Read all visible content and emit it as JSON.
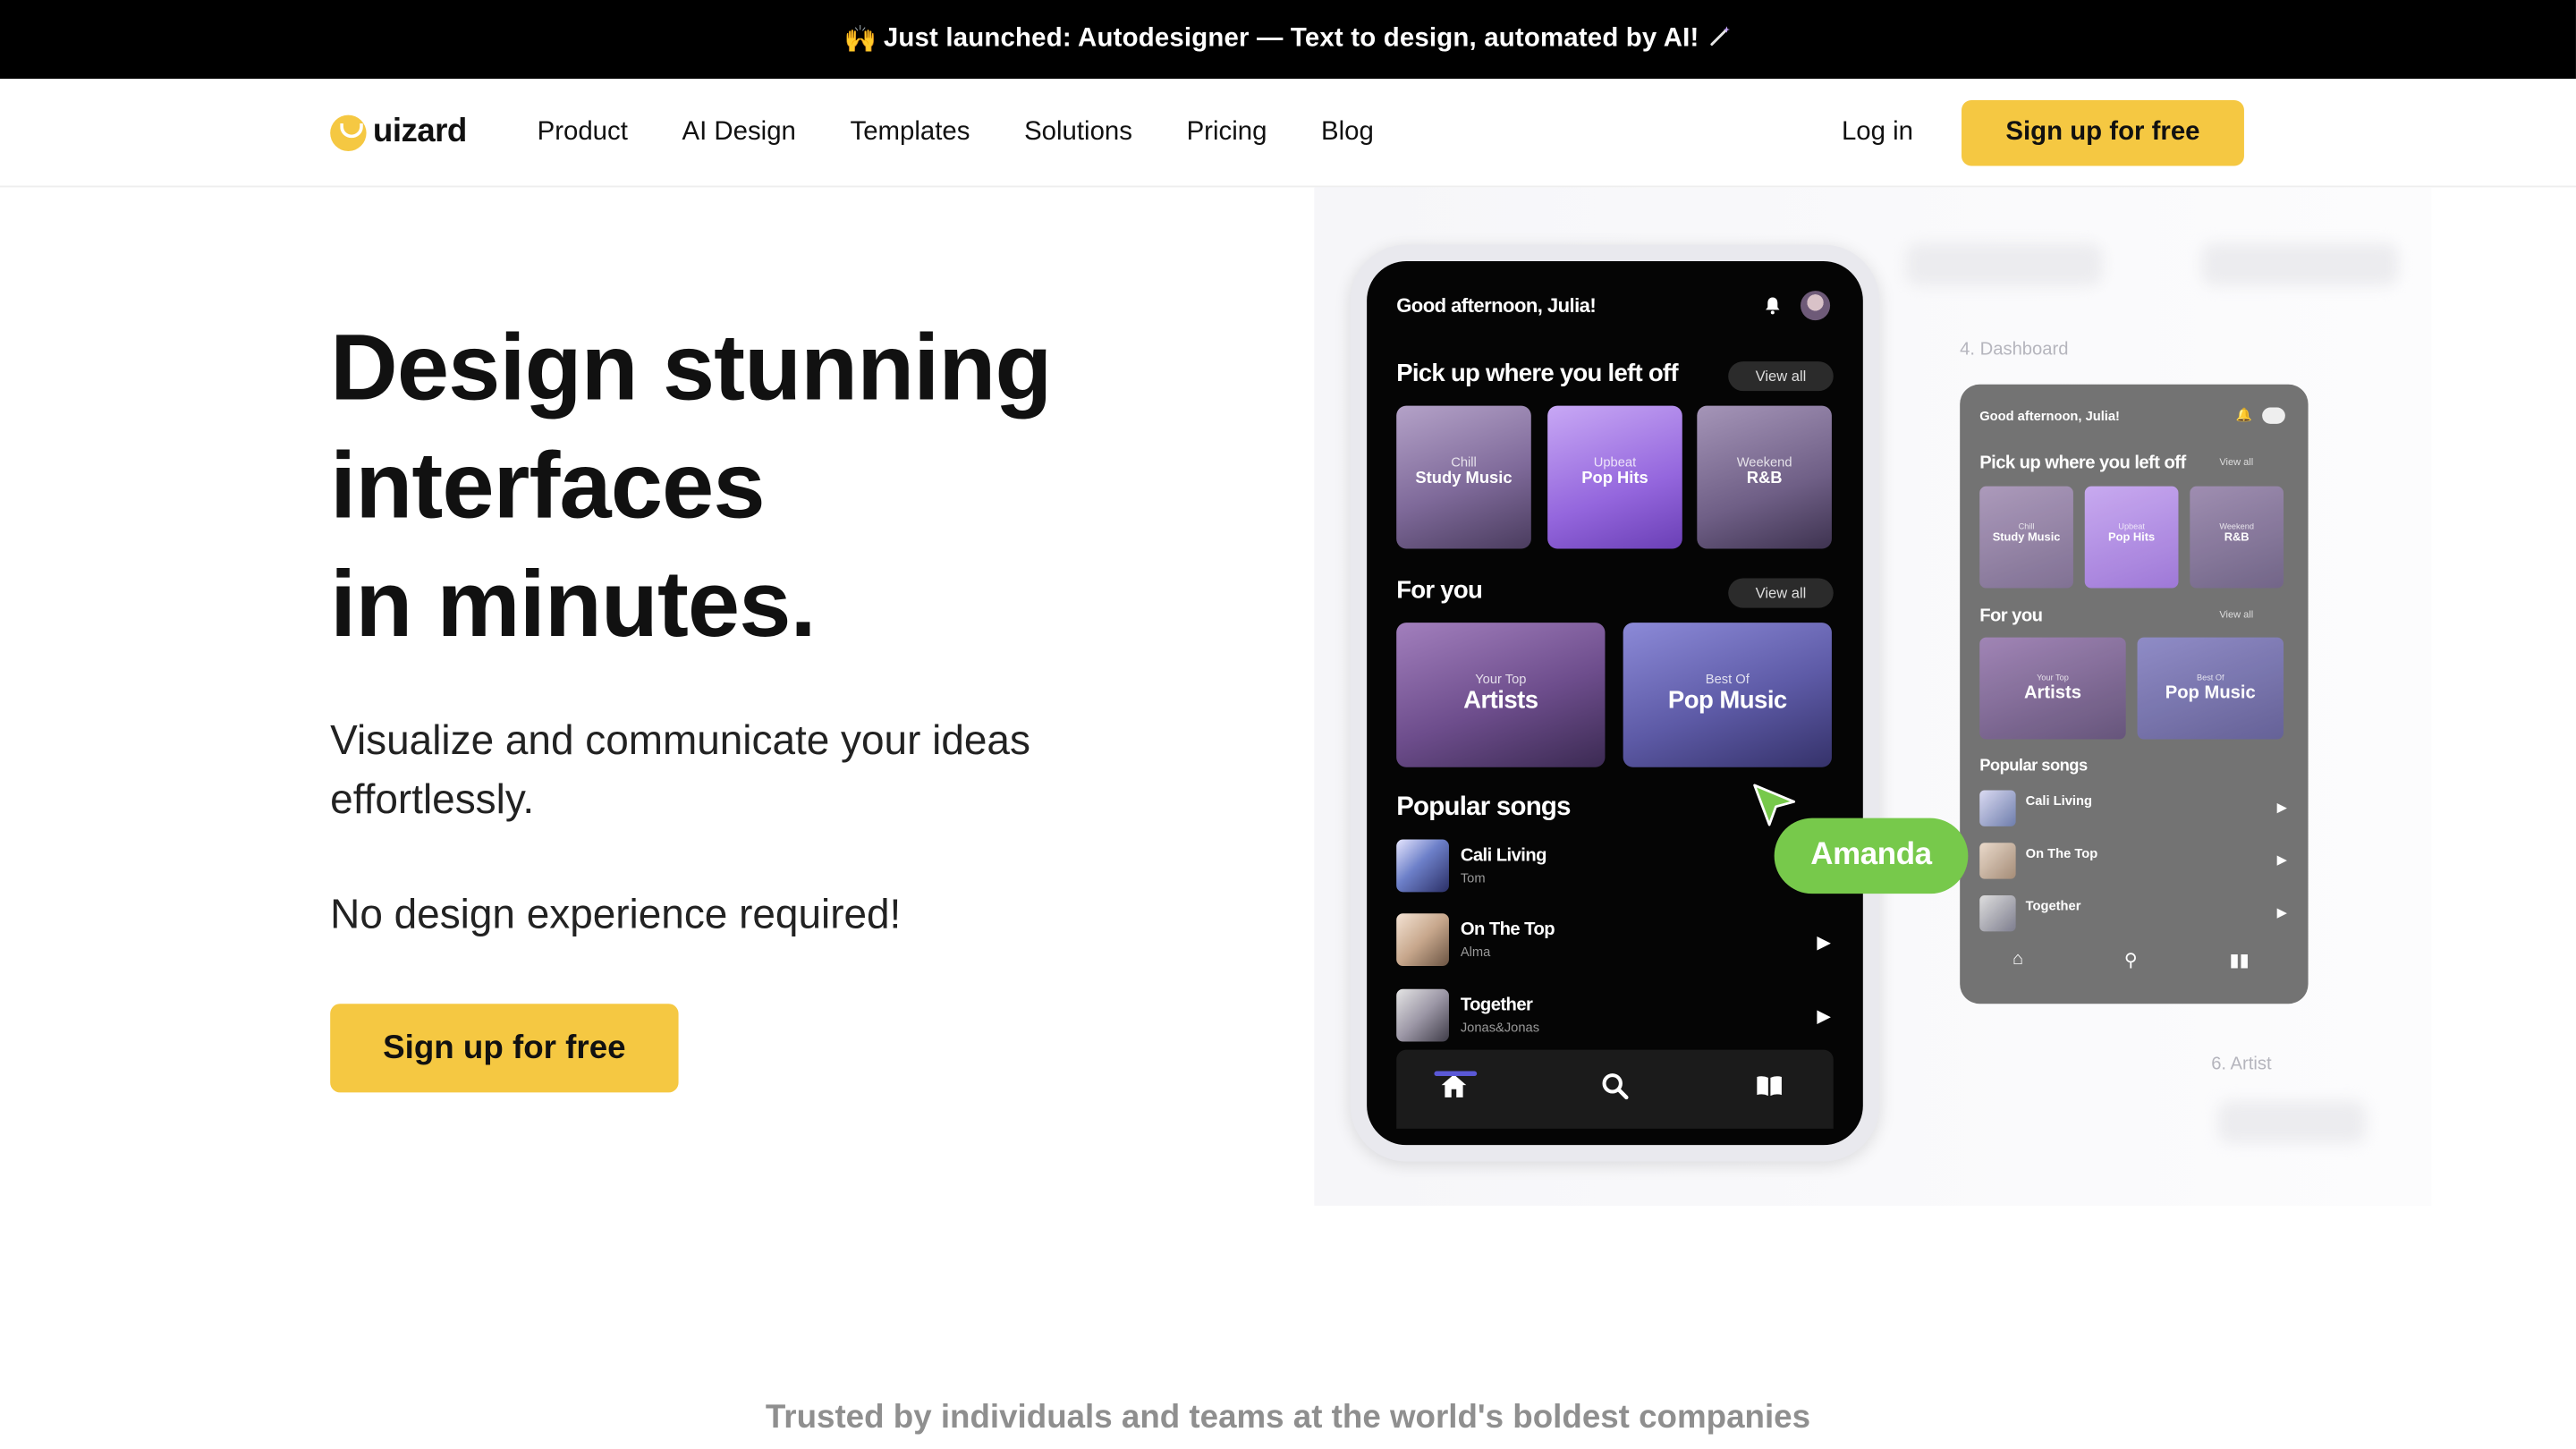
{
  "banner": {
    "emoji": "🙌",
    "text": "Just launched: Autodesigner — Text to design, automated by AI!",
    "trailing_icon": "magic-wand-icon"
  },
  "nav": {
    "logo_text": "uizard",
    "links": [
      "Product",
      "AI Design",
      "Templates",
      "Solutions",
      "Pricing",
      "Blog"
    ],
    "login": "Log in",
    "cta": "Sign up for free"
  },
  "hero": {
    "title_lines": [
      "Design stunning",
      "interfaces",
      "in minutes."
    ],
    "subtitle": "Visualize and communicate your ideas effortlessly.",
    "subtitle2": "No design experience required!",
    "cta": "Sign up for free"
  },
  "phone": {
    "greeting": "Good afternoon, Julia!",
    "section1": "Pick up where you left off",
    "view_all": "View all",
    "tiles": [
      {
        "line1": "Chill",
        "line2": "Study Music"
      },
      {
        "line1": "Upbeat",
        "line2": "Pop Hits"
      },
      {
        "line1": "Weekend",
        "line2": "R&B"
      }
    ],
    "section2": "For you",
    "big_tiles": [
      {
        "line1": "Your Top",
        "line2": "Artists"
      },
      {
        "line1": "Best Of",
        "line2": "Pop Music"
      }
    ],
    "section3": "Popular songs",
    "songs": [
      {
        "name": "Cali Living",
        "artist": "Tom"
      },
      {
        "name": "On The Top",
        "artist": "Alma"
      },
      {
        "name": "Together",
        "artist": "Jonas&Jonas"
      }
    ]
  },
  "collab": {
    "cursor_name": "Amanda",
    "color": "#77c94b"
  },
  "dashboard": {
    "label": "4. Dashboard",
    "label2": "6. Artist",
    "greeting": "Good afternoon, Julia!",
    "section1": "Pick up where you left off",
    "view_all": "View all",
    "tiles": [
      {
        "line1": "Chill",
        "line2": "Study Music"
      },
      {
        "line1": "Upbeat",
        "line2": "Pop Hits"
      },
      {
        "line1": "Weekend",
        "line2": "R&B"
      }
    ],
    "section2": "For you",
    "big_tiles": [
      {
        "line1": "Your Top",
        "line2": "Artists"
      },
      {
        "line1": "Best Of",
        "line2": "Pop Music"
      }
    ],
    "section3": "Popular songs",
    "songs": [
      {
        "name": "Cali Living"
      },
      {
        "name": "On The Top"
      },
      {
        "name": "Together"
      }
    ]
  },
  "footer": {
    "trusted": "Trusted by individuals and teams at the world's boldest companies"
  },
  "colors": {
    "accent": "#f5c842",
    "banner_bg": "#000000",
    "collab_green": "#77c94b"
  }
}
